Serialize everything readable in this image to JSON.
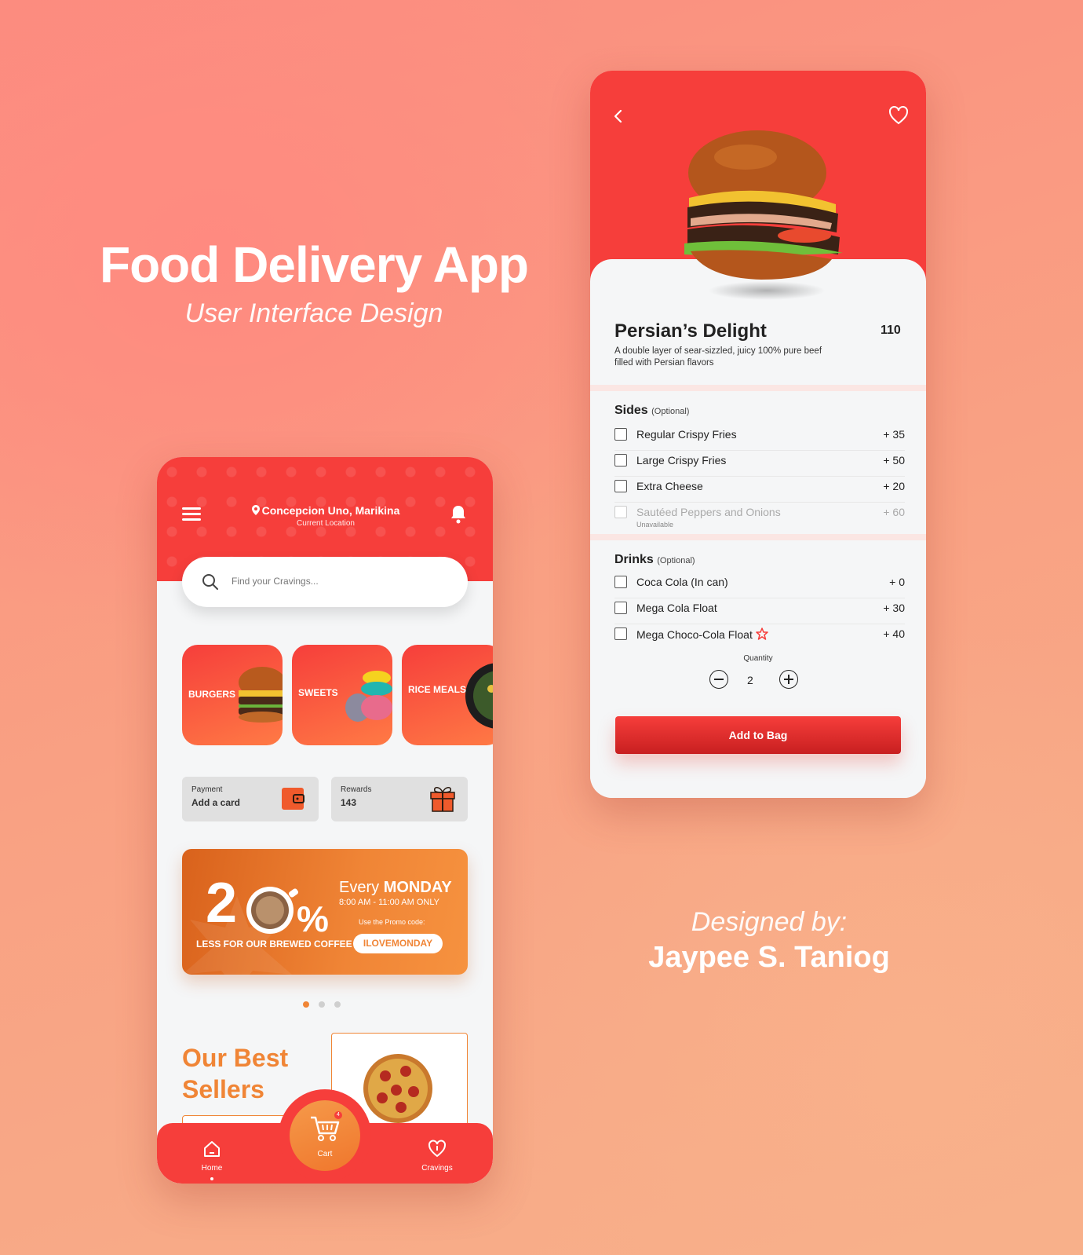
{
  "headline": {
    "title": "Food Delivery App",
    "subtitle": "User Interface Design"
  },
  "credit": {
    "line1": "Designed by:",
    "name": "Jaypee S. Taniog"
  },
  "home": {
    "location": "Concepcion Uno, Marikina",
    "location_sub": "Current Location",
    "search_placeholder": "Find your Cravings...",
    "categories": [
      {
        "label": "BURGERS"
      },
      {
        "label": "SWEETS"
      },
      {
        "label": "RICE MEALS"
      }
    ],
    "payment": {
      "label": "Payment",
      "value": "Add a card"
    },
    "rewards": {
      "label": "Rewards",
      "value": "143"
    },
    "promo": {
      "big": "2",
      "pct": "%",
      "every": "Every",
      "day": "MONDAY",
      "hours": "8:00 AM - 11:00 AM ONLY",
      "use_code": "Use the Promo code:",
      "less": "LESS FOR OUR BREWED COFFEE",
      "code": "ILOVEMONDAY"
    },
    "best_sellers_line1": "Our Best",
    "best_sellers_line2": "Sellers",
    "nav": {
      "home": "Home",
      "cart": "Cart",
      "cart_count": "4",
      "cravings": "Cravings"
    }
  },
  "product": {
    "name": "Persian’s Delight",
    "price": "110",
    "description": "A double layer of sear-sizzled, juicy 100% pure beef filled with Persian flavors",
    "sides_title": "Sides",
    "sides_optional": "(Optional)",
    "sides": [
      {
        "label": "Regular Crispy Fries",
        "price": "+ 35"
      },
      {
        "label": "Large Crispy Fries",
        "price": "+ 50"
      },
      {
        "label": "Extra Cheese",
        "price": "+ 20"
      },
      {
        "label": "Sautéed Peppers and Onions",
        "price": "+ 60",
        "note": "Unavailable"
      }
    ],
    "drinks_title": "Drinks",
    "drinks_optional": "(Optional)",
    "drinks": [
      {
        "label": "Coca Cola (In can)",
        "price": "+ 0"
      },
      {
        "label": "Mega Cola Float",
        "price": "+ 30"
      },
      {
        "label": "Mega Choco-Cola Float",
        "price": "+ 40"
      }
    ],
    "quantity_label": "Quantity",
    "quantity": "2",
    "add_label": "Add to Bag"
  },
  "colors": {
    "red": "#f63e3b",
    "orange": "#f08536"
  }
}
